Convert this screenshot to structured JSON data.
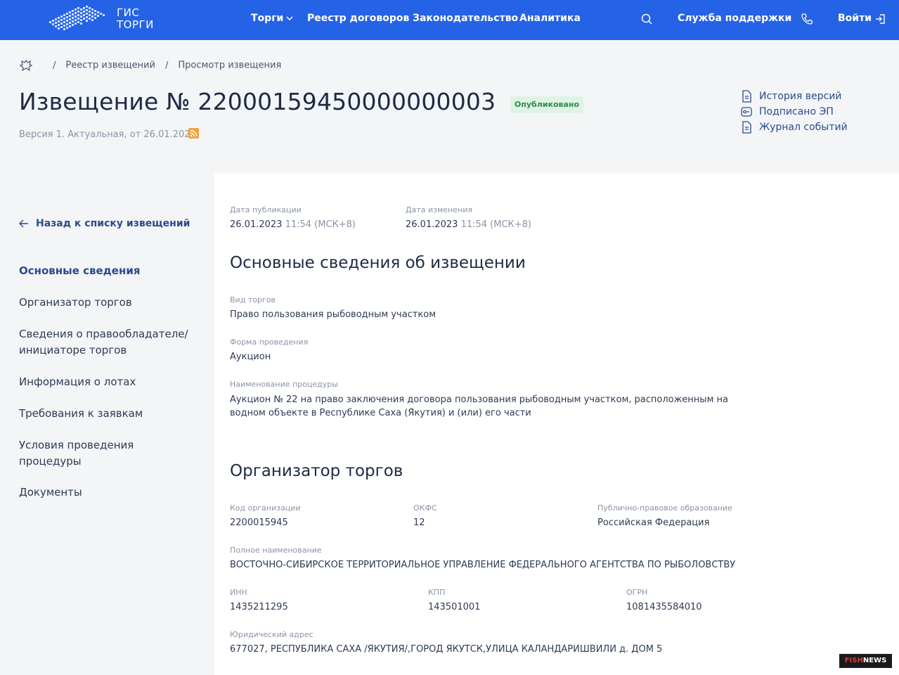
{
  "header": {
    "logo_line1": "ГИС",
    "logo_line2": "ТОРГИ",
    "nav": [
      "Торги",
      "Реестр договоров",
      "Законодательство",
      "Аналитика"
    ],
    "support": "Служба поддержки",
    "login": "Войти"
  },
  "breadcrumbs": [
    "Реестр извещений",
    "Просмотр извещения"
  ],
  "title": "Извещение № 22000159450000000003",
  "status": "Опубликовано",
  "version_text": "Версия 1. Актуальная, от 26.01.2023",
  "side_links": [
    "История версий",
    "Подписано ЭП",
    "Журнал событий"
  ],
  "leftnav": {
    "back": "Назад к списку извещений",
    "items": [
      "Основные сведения",
      "Организатор торгов",
      "Сведения о правообладателе/ инициаторе торгов",
      "Информация о лотах",
      "Требования к заявкам",
      "Условия проведения процедуры",
      "Документы"
    ],
    "active_index": 0
  },
  "dates": {
    "published_label": "Дата публикации",
    "published_date": "26.01.2023",
    "published_time": "11:54 (МСК+8)",
    "changed_label": "Дата изменения",
    "changed_date": "26.01.2023",
    "changed_time": "11:54 (МСК+8)"
  },
  "main_info": {
    "heading": "Основные сведения об извещении",
    "type_label": "Вид торгов",
    "type_value": "Право пользования рыбоводным участком",
    "form_label": "Форма проведения",
    "form_value": "Аукцион",
    "name_label": "Наименование процедуры",
    "name_value": "Аукцион № 22 на право заключения договора пользования рыбоводным участком, расположенным на водном объекте в Республике Саха (Якутия) и (или) его части"
  },
  "organizer": {
    "heading": "Организатор торгов",
    "code_label": "Код организации",
    "code_value": "2200015945",
    "okfs_label": "ОКФС",
    "okfs_value": "12",
    "ppo_label": "Публично-правовое образование",
    "ppo_value": "Российская Федерация",
    "fullname_label": "Полное наименование",
    "fullname_value": "ВОСТОЧНО-СИБИРСКОЕ ТЕРРИТОРИАЛЬНОЕ УПРАВЛЕНИЕ ФЕДЕРАЛЬНОГО АГЕНТСТВА ПО РЫБОЛОВСТВУ",
    "inn_label": "ИНН",
    "inn_value": "1435211295",
    "kpp_label": "КПП",
    "kpp_value": "143501001",
    "ogrn_label": "ОГРН",
    "ogrn_value": "1081435584010",
    "address_label": "Юридический адрес",
    "address_value": "677027, РЕСПУБЛИКА САХА /ЯКУТИЯ/,ГОРОД ЯКУТСК,УЛИЦА КАЛАНДАРИШВИЛИ д. ДОМ 5"
  },
  "watermark": {
    "part1": "FISH",
    "part2": "NEWS"
  },
  "colors": {
    "header_bg": "#2563e6",
    "accent_link": "#2b4a8c",
    "badge_bg": "#dff3e4",
    "badge_text": "#2e8b4a"
  }
}
